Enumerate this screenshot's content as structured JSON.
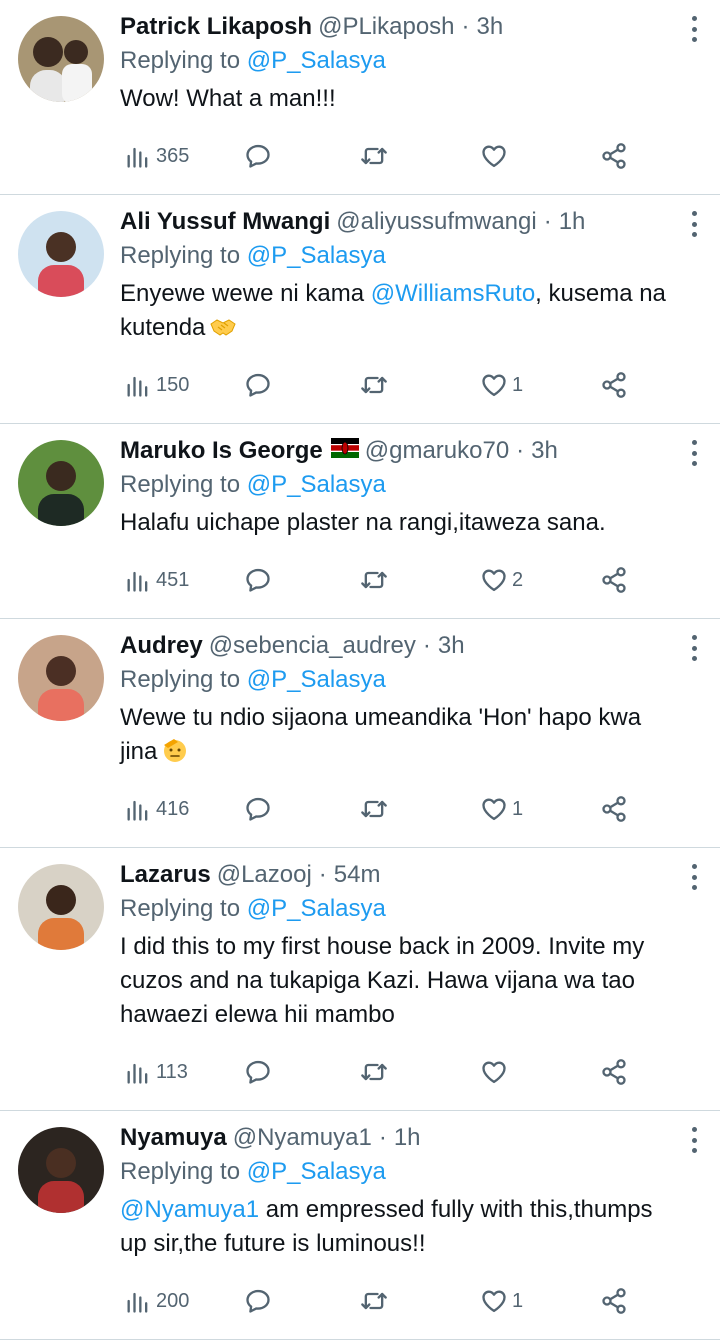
{
  "tweets": [
    {
      "name": "Patrick Likaposh",
      "handle": "@PLikaposh",
      "time": "3h",
      "replying_prefix": "Replying to",
      "replying_to": "@P_Salasya",
      "text_parts": [
        "Wow! What a man!!!"
      ],
      "views": "365",
      "likes": "",
      "avatar_colors": {
        "bg": "#a89674",
        "skin": "#3b2a20",
        "shirt": "#e8e8e8"
      }
    },
    {
      "name": "Ali Yussuf Mwangi",
      "handle": "@aliyussufmwangi",
      "time": "1h",
      "replying_prefix": "Replying to",
      "replying_to": "@P_Salasya",
      "text_before": "Enyewe wewe ni kama ",
      "mention": "@WilliamsRuto",
      "text_after": ", kusema na kutenda",
      "emoji": "handshake-emoji",
      "views": "150",
      "likes": "1",
      "avatar_colors": {
        "bg": "#cfe2f0",
        "skin": "#4a3124",
        "shirt": "#d94c5a"
      }
    },
    {
      "name": "Maruko Is George",
      "flag": "kenya-flag",
      "handle": "@gmaruko70",
      "time": "3h",
      "replying_prefix": "Replying to",
      "replying_to": "@P_Salasya",
      "text_parts": [
        "Halafu uichape plaster na rangi,itaweza sana."
      ],
      "views": "451",
      "likes": "2",
      "avatar_colors": {
        "bg": "#5f8f3e",
        "skin": "#3a2a1f",
        "shirt": "#1e2a24"
      }
    },
    {
      "name": "Audrey",
      "handle": "@sebencia_audrey",
      "time": "3h",
      "replying_prefix": "Replying to",
      "replying_to": "@P_Salasya",
      "text_before": "Wewe tu ndio sijaona umeandika 'Hon'  hapo kwa jina",
      "emoji": "saluting-face-emoji",
      "views": "416",
      "likes": "1",
      "avatar_colors": {
        "bg": "#c7a48a",
        "skin": "#4b2f24",
        "shirt": "#e87060"
      }
    },
    {
      "name": "Lazarus",
      "handle": "@Lazooj",
      "time": "54m",
      "replying_prefix": "Replying to",
      "replying_to": "@P_Salasya",
      "text_parts": [
        "I did this to my first house back in 2009. Invite my cuzos and na tukapiga Kazi. Hawa vijana wa tao hawaezi elewa hii mambo"
      ],
      "views": "113",
      "likes": "",
      "avatar_colors": {
        "bg": "#d8d2c6",
        "skin": "#3a261b",
        "shirt": "#e07a3a"
      }
    },
    {
      "name": "Nyamuya",
      "handle": "@Nyamuya1",
      "time": "1h",
      "replying_prefix": "Replying to",
      "replying_to": "@P_Salasya",
      "mention_first": "@Nyamuya1",
      "text_after": "  am empressed fully with this,thumps up sir,the future is luminous!!",
      "views": "200",
      "likes": "1",
      "avatar_colors": {
        "bg": "#2c2520",
        "skin": "#4a2f22",
        "shirt": "#b03030"
      }
    }
  ],
  "colors": {
    "primary_text": "#0f1419",
    "secondary_text": "#536471",
    "link": "#1d9bf0",
    "divider": "#cfd9de"
  },
  "icons": {
    "views": "views-icon",
    "reply": "reply-icon",
    "retweet": "retweet-icon",
    "like": "like-icon",
    "share": "share-icon",
    "more": "more-icon"
  }
}
